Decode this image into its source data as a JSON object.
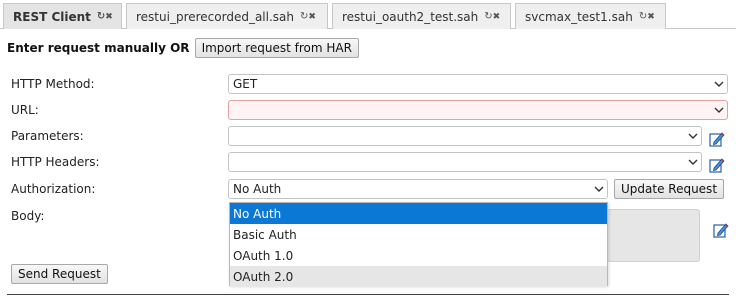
{
  "tabs": [
    {
      "label": "REST Client",
      "active": true
    },
    {
      "label": "restui_prerecorded_all.sah",
      "active": false
    },
    {
      "label": "restui_oauth2_test.sah",
      "active": false
    },
    {
      "label": "svcmax_test1.sah",
      "active": false
    }
  ],
  "tab_refresh_glyph": "↻",
  "tab_close_glyph": "✖",
  "header": {
    "label": "Enter request manually OR",
    "import_button": "Import request from HAR"
  },
  "form": {
    "method_label": "HTTP Method:",
    "method_value": "GET",
    "url_label": "URL:",
    "url_value": "",
    "params_label": "Parameters:",
    "params_value": "",
    "headers_label": "HTTP Headers:",
    "headers_value": "",
    "auth_label": "Authorization:",
    "auth_value": "No Auth",
    "update_button": "Update Request",
    "body_label": "Body:",
    "send_button": "Send Request"
  },
  "auth_options": [
    "No Auth",
    "Basic Auth",
    "OAuth 1.0",
    "OAuth 2.0"
  ],
  "colors": {
    "selected_option": "#0a78d4",
    "url_error_bg": "#fff3f3",
    "url_error_border": "#e8a0a0"
  },
  "icons": {
    "edit": "edit-pencil-icon",
    "chevron": "chevron-down-icon"
  }
}
